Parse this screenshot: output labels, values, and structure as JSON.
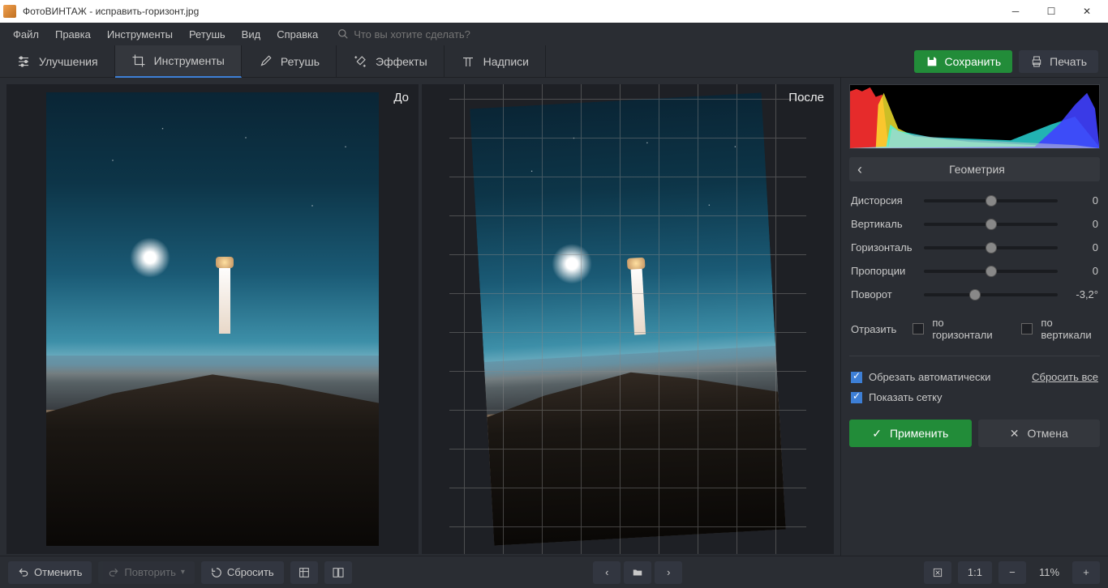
{
  "titlebar": {
    "app": "ФотоВИНТАЖ",
    "file": "исправить-горизонт.jpg"
  },
  "menu": {
    "file": "Файл",
    "edit": "Правка",
    "tools": "Инструменты",
    "retouch": "Ретушь",
    "view": "Вид",
    "help": "Справка",
    "search_ph": "Что вы хотите сделать?"
  },
  "tabs": {
    "enhance": "Улучшения",
    "tools": "Инструменты",
    "retouch": "Ретушь",
    "effects": "Эффекты",
    "text": "Надписи"
  },
  "header_btns": {
    "save": "Сохранить",
    "print": "Печать"
  },
  "compare": {
    "before": "До",
    "after": "После"
  },
  "panel": {
    "title": "Геометрия",
    "sliders": [
      {
        "label": "Дисторсия",
        "value": "0",
        "pos": 50
      },
      {
        "label": "Вертикаль",
        "value": "0",
        "pos": 50
      },
      {
        "label": "Горизонталь",
        "value": "0",
        "pos": 50
      },
      {
        "label": "Пропорции",
        "value": "0",
        "pos": 50
      },
      {
        "label": "Поворот",
        "value": "-3,2°",
        "pos": 38
      }
    ],
    "flip_label": "Отразить",
    "flip_h": "по горизонтали",
    "flip_v": "по вертикали",
    "auto_crop": "Обрезать автоматически",
    "show_grid": "Показать сетку",
    "reset": "Сбросить все",
    "apply": "Применить",
    "cancel": "Отмена"
  },
  "bottom": {
    "undo": "Отменить",
    "redo": "Повторить",
    "reset": "Сбросить",
    "zoom": "11%",
    "ratio": "1:1"
  }
}
